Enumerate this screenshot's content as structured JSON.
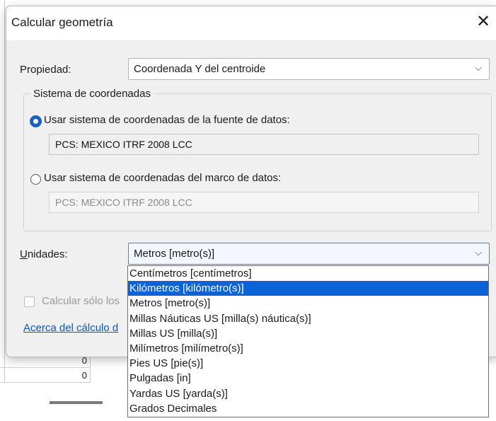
{
  "background": {
    "cells": [
      "0",
      "0"
    ]
  },
  "dialog": {
    "title": "Calcular geometría",
    "close_glyph": "✕",
    "property": {
      "label": "Propiedad:",
      "value": "Coordenada Y del centroide",
      "chevron": "⌵"
    },
    "coord_system": {
      "legend": "Sistema de coordenadas",
      "option_source": {
        "label": "Usar sistema de coordenadas de la fuente de datos:",
        "selected": true,
        "value": "PCS: MEXICO ITRF 2008 LCC"
      },
      "option_frame": {
        "label": "Usar sistema de coordenadas del marco de datos:",
        "selected": false,
        "value": "PCS: MEXICO ITRF 2008 LCC"
      }
    },
    "units": {
      "label_accel": "U",
      "label_rest": "nidades:",
      "value": "Metros [metro(s)]",
      "chevron": "⌵",
      "options": [
        "Centímetros [centímetros]",
        "Kilómetros [kilómetro(s)]",
        "Metros [metro(s)]",
        "Millas Náuticas US [milla(s) náutica(s)]",
        "Millas US [milla(s)]",
        "Milímetros [milímetro(s)]",
        "Pies US [pie(s)]",
        "Pulgadas [in]",
        "Yardas US [yarda(s)]",
        "Grados Decimales"
      ],
      "highlighted_index": 1
    },
    "calc_selected_partial": "Calcular sólo los",
    "about_link_partial": "Acerca del cálculo d"
  }
}
